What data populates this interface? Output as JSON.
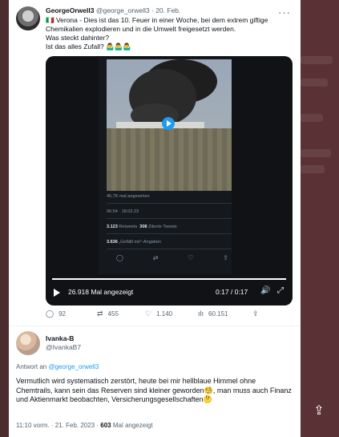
{
  "tweet": {
    "author_name": "GeorgeOrwell3",
    "author_handle": "@george_orwell3",
    "separator": "·",
    "date": "20. Feb.",
    "more": "···",
    "text_line1": "🇮🇹 Verona - Dies ist das 10. Feuer in einer Woche, bei dem extrem giftige Chemikalien explodieren und in die Umwelt freigesetzt werden.",
    "text_line2": "Was steckt dahinter?",
    "text_line3": "Ist das alles Zufall? 🤷‍♂️🤷‍♂️🤷‍♂️"
  },
  "video": {
    "inner_views": "45,7K mal angesehen",
    "inner_time": "06:54 · 18.02.23",
    "inner_retweets_count": "3.123",
    "inner_retweets_label": "Retweets",
    "inner_quotes_count": "308",
    "inner_quotes_label": "Zitierte Tweets",
    "inner_likes_count": "3.636",
    "inner_likes_label": "„Gefällt mir\"-Angaben",
    "views_label": "26.918 Mal angezeigt",
    "time_label": "0:17 / 0:17",
    "progress": 1.0
  },
  "actions": {
    "replies": "92",
    "retweets": "455",
    "likes": "1.140",
    "views": "60.151"
  },
  "reply": {
    "author_name": "Ivanka-B",
    "author_handle": "@IvankaB7",
    "replying_prefix": "Antwort an",
    "replying_to": "@george_orwell3",
    "text": "Vermutlich wird systematisch zerstört, heute  bei mir hellblaue Himmel ohne Chemtrails, kann sein das Reserven sind kleiner geworden🧐, man muss auch Finanz und Aktienmarkt beobachten, Versicherungsgesellschaften🤔",
    "timestamp": "11:10 vorm. · 21. Feb. 2023 ·",
    "view_count": "603",
    "view_label": "Mal angezeigt"
  },
  "colors": {
    "accent": "#1d9bf0",
    "secondary_text": "#536471",
    "backdrop": "#4a2b2f"
  }
}
